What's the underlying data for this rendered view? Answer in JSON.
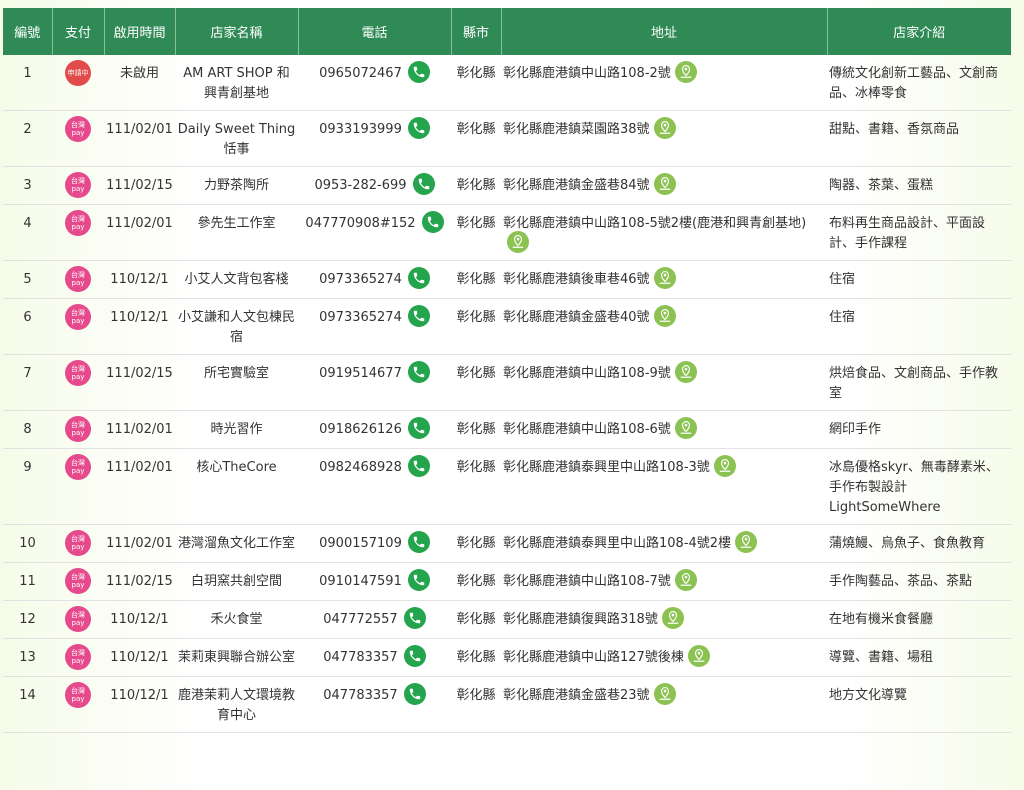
{
  "headers": [
    "編號",
    "支付",
    "啟用時間",
    "店家名稱",
    "電話",
    "縣市",
    "地址",
    "店家介紹"
  ],
  "badges": {
    "apply": "申請中",
    "tw_line1": "台灣",
    "tw_line2": "pay"
  },
  "colors": {
    "header_bg": "#2f8a55",
    "taiwanpay": "#e74a8c",
    "applying": "#e24b4b",
    "phone_icon": "#23a44d",
    "map_icon": "#8cc252"
  },
  "rows": [
    {
      "no": "1",
      "pay": "apply",
      "date": "未啟用",
      "name": "AM ART SHOP 和興青創基地",
      "phone": "0965072467",
      "county": "彰化縣",
      "addr": "彰化縣鹿港鎮中山路108-2號",
      "intro": "傳統文化創新工藝品、文創商品、冰棒零食"
    },
    {
      "no": "2",
      "pay": "tw",
      "date": "111/02/01",
      "name": "Daily Sweet Thing 恬事",
      "phone": "0933193999",
      "county": "彰化縣",
      "addr": "彰化縣鹿港鎮菜園路38號",
      "intro": "甜點、書籍、香氛商品"
    },
    {
      "no": "3",
      "pay": "tw",
      "date": "111/02/15",
      "name": "力野茶陶所",
      "phone": "0953-282-699",
      "county": "彰化縣",
      "addr": "彰化縣鹿港鎮金盛巷84號",
      "intro": "陶器、茶葉、蛋糕"
    },
    {
      "no": "4",
      "pay": "tw",
      "date": "111/02/01",
      "name": "參先生工作室",
      "phone": "047770908#152",
      "county": "彰化縣",
      "addr": "彰化縣鹿港鎮中山路108-5號2樓(鹿港和興青創基地)",
      "intro": "布料再生商品設計、平面設計、手作課程"
    },
    {
      "no": "5",
      "pay": "tw",
      "date": "110/12/1",
      "name": "小艾人文背包客棧",
      "phone": "0973365274",
      "county": "彰化縣",
      "addr": "彰化縣鹿港鎮後車巷46號",
      "intro": "住宿"
    },
    {
      "no": "6",
      "pay": "tw",
      "date": "110/12/1",
      "name": "小艾謙和人文包棟民宿",
      "phone": "0973365274",
      "county": "彰化縣",
      "addr": "彰化縣鹿港鎮金盛巷40號",
      "intro": "住宿"
    },
    {
      "no": "7",
      "pay": "tw",
      "date": "111/02/15",
      "name": "所宅實驗室",
      "phone": "0919514677",
      "county": "彰化縣",
      "addr": "彰化縣鹿港鎮中山路108-9號",
      "intro": "烘焙食品、文創商品、手作教室"
    },
    {
      "no": "8",
      "pay": "tw",
      "date": "111/02/01",
      "name": "時光習作",
      "phone": "0918626126",
      "county": "彰化縣",
      "addr": "彰化縣鹿港鎮中山路108-6號",
      "intro": "網印手作"
    },
    {
      "no": "9",
      "pay": "tw",
      "date": "111/02/01",
      "name": "核心TheCore",
      "phone": "0982468928",
      "county": "彰化縣",
      "addr": "彰化縣鹿港鎮泰興里中山路108-3號",
      "intro": "冰島優格skyr、無毒酵素米、手作布製設計LightSomeWhere"
    },
    {
      "no": "10",
      "pay": "tw",
      "date": "111/02/01",
      "name": "港灣溜魚文化工作室",
      "phone": "0900157109",
      "county": "彰化縣",
      "addr": "彰化縣鹿港鎮泰興里中山路108-4號2樓",
      "intro": "蒲燒鰻、烏魚子、食魚教育"
    },
    {
      "no": "11",
      "pay": "tw",
      "date": "111/02/15",
      "name": "白玥窯共創空間",
      "phone": "0910147591",
      "county": "彰化縣",
      "addr": "彰化縣鹿港鎮中山路108-7號",
      "intro": "手作陶藝品、茶品、茶點"
    },
    {
      "no": "12",
      "pay": "tw",
      "date": "110/12/1",
      "name": "禾火食堂",
      "phone": "047772557",
      "county": "彰化縣",
      "addr": "彰化縣鹿港鎮復興路318號",
      "intro": "在地有機米食餐廳"
    },
    {
      "no": "13",
      "pay": "tw",
      "date": "110/12/1",
      "name": "茉莉東興聯合辦公室",
      "phone": "047783357",
      "county": "彰化縣",
      "addr": "彰化縣鹿港鎮中山路127號後棟",
      "intro": "導覽、書籍、場租"
    },
    {
      "no": "14",
      "pay": "tw",
      "date": "110/12/1",
      "name": "鹿港茉莉人文環境教育中心",
      "phone": "047783357",
      "county": "彰化縣",
      "addr": "彰化縣鹿港鎮金盛巷23號",
      "intro": "地方文化導覽"
    }
  ]
}
